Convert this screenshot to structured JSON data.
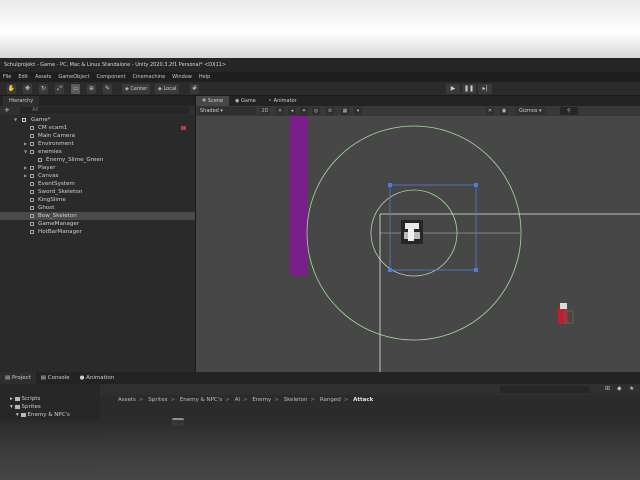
{
  "window": {
    "title": "Schulprojekt - Game - PC, Mac & Linux Standalone - Unity 2020.3.2f1 Personal* <DX11>"
  },
  "menu": [
    "File",
    "Edit",
    "Assets",
    "GameObject",
    "Component",
    "Cinemachine",
    "Window",
    "Help"
  ],
  "toolbar": {
    "pivot_label": "Center",
    "space_label": "Local"
  },
  "hierarchy": {
    "tab": "Hierarchy",
    "search_placeholder": "All",
    "rows": [
      {
        "label": "Game*"
      },
      {
        "label": "CM vcam1"
      },
      {
        "label": "Main Camera"
      },
      {
        "label": "Environment"
      },
      {
        "label": "enemies"
      },
      {
        "label": "Enemy_Slime_Green"
      },
      {
        "label": "Player"
      },
      {
        "label": "Canvas"
      },
      {
        "label": "EventSystem"
      },
      {
        "label": "Sword_Skeleton"
      },
      {
        "label": "KingSlime"
      },
      {
        "label": "Ghost"
      },
      {
        "label": "Bow_Skeleton"
      },
      {
        "label": "GameManager"
      },
      {
        "label": "HotBarManager"
      }
    ],
    "selected_index": 12
  },
  "scene": {
    "tabs": [
      "Scene",
      "Game",
      "Animator"
    ],
    "shading": "Shaded",
    "mode_label": "2D",
    "gizmos_label": "Gizmos"
  },
  "bottom": {
    "tabs": [
      "Project",
      "Console",
      "Animation"
    ],
    "tree": [
      "Scripts",
      "Sprites",
      "Enemy & NPC's"
    ],
    "breadcrumb": [
      "Assets",
      "Sprites",
      "Enemy & NPC's",
      "AI",
      "Enemy",
      "Skeleton",
      "Ranged",
      "Attack"
    ]
  },
  "icons": [
    "hand-icon",
    "move-icon",
    "rotate-icon",
    "scale-icon",
    "rect-icon",
    "transform-icon",
    "custom-icon",
    "play-icon",
    "pause-icon",
    "step-icon"
  ],
  "colors": {
    "wall_purple": "#7a1f8a",
    "gizmo_green": "#a6d9a0",
    "selection_blue": "#4f7bd8"
  }
}
